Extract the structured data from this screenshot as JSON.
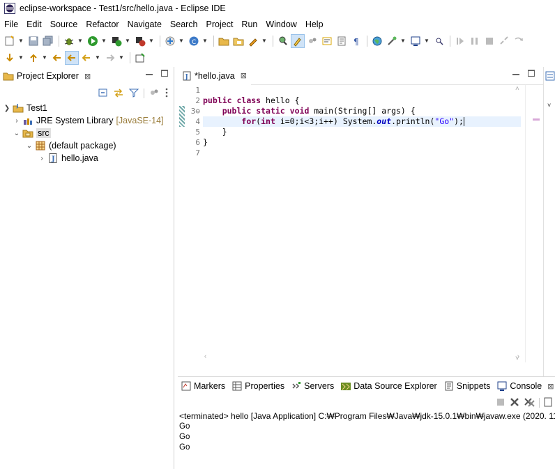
{
  "window": {
    "title": "eclipse-workspace - Test1/src/hello.java - Eclipse IDE"
  },
  "menu": [
    "File",
    "Edit",
    "Source",
    "Refactor",
    "Navigate",
    "Search",
    "Project",
    "Run",
    "Window",
    "Help"
  ],
  "project_explorer": {
    "tab_label": "Project Explorer",
    "tree": {
      "project": "Test1",
      "jre": "JRE System Library",
      "jre_decor": "[JavaSE-14]",
      "src": "src",
      "package": "(default package)",
      "file": "hello.java"
    }
  },
  "editor": {
    "tab_label": "*hello.java",
    "line_numbers": [
      "1",
      "2",
      "3⊖",
      "4",
      "5",
      "6",
      "7"
    ]
  },
  "console": {
    "tabs": [
      "Markers",
      "Properties",
      "Servers",
      "Data Source Explorer",
      "Snippets",
      "Console"
    ],
    "header": "<terminated> hello [Java Application] C:₩Program Files₩Java₩jdk-15.0.1₩bin₩javaw.exe  (2020. 11",
    "output": [
      "Go",
      "Go",
      "Go"
    ]
  },
  "colors": {
    "keyword": "#7f0055",
    "string": "#2a00ff",
    "field": "#0000c0",
    "current_line": "#e8f2fe"
  }
}
